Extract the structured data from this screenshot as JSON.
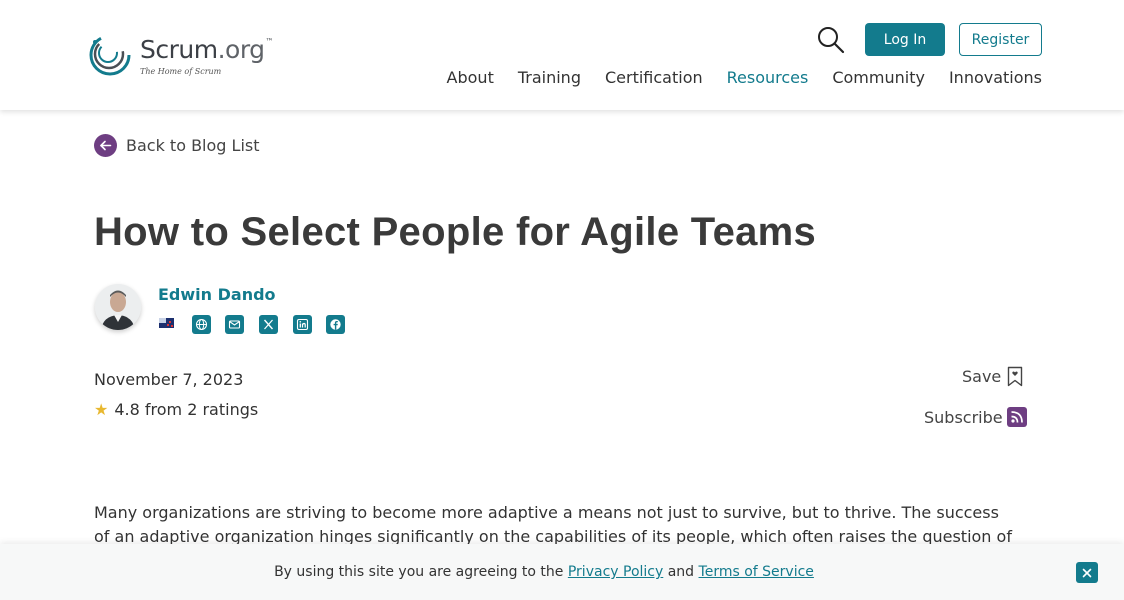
{
  "header": {
    "logo": {
      "name": "Scrum",
      "suffix": ".org",
      "trademark": "™",
      "tagline": "The Home of Scrum"
    },
    "search_icon": "search-icon",
    "login_label": "Log In",
    "register_label": "Register",
    "nav": [
      {
        "label": "About"
      },
      {
        "label": "Training"
      },
      {
        "label": "Certification"
      },
      {
        "label": "Resources",
        "active": true
      },
      {
        "label": "Community"
      },
      {
        "label": "Innovations"
      }
    ]
  },
  "back_link": {
    "label": "Back to Blog List",
    "icon": "arrow-left-icon"
  },
  "article": {
    "title": "How to Select People for Agile Teams",
    "author": {
      "name": "Edwin Dando",
      "flag_icon": "new-zealand-flag-icon",
      "social_icons": [
        "globe-icon",
        "email-icon",
        "x-icon",
        "linkedin-icon",
        "facebook-icon"
      ]
    },
    "date": "November 7, 2023",
    "rating_text": "4.8 from 2 ratings",
    "save_label": "Save",
    "subscribe_label": "Subscribe",
    "body_line1": "Many organizations are striving to become more adaptive a means not just to survive, but to thrive.  The success",
    "body_line2": "of an adaptive organization hinges significantly on the capabilities of its people, which often raises the question of"
  },
  "cookie": {
    "prefix": "By using this site you are agreeing to the ",
    "privacy_label": "Privacy Policy",
    "and": " and ",
    "terms_label": "Terms of Service"
  },
  "colors": {
    "brand": "#137b8d",
    "accent_purple": "#6e3e82",
    "star": "#e8b830"
  }
}
